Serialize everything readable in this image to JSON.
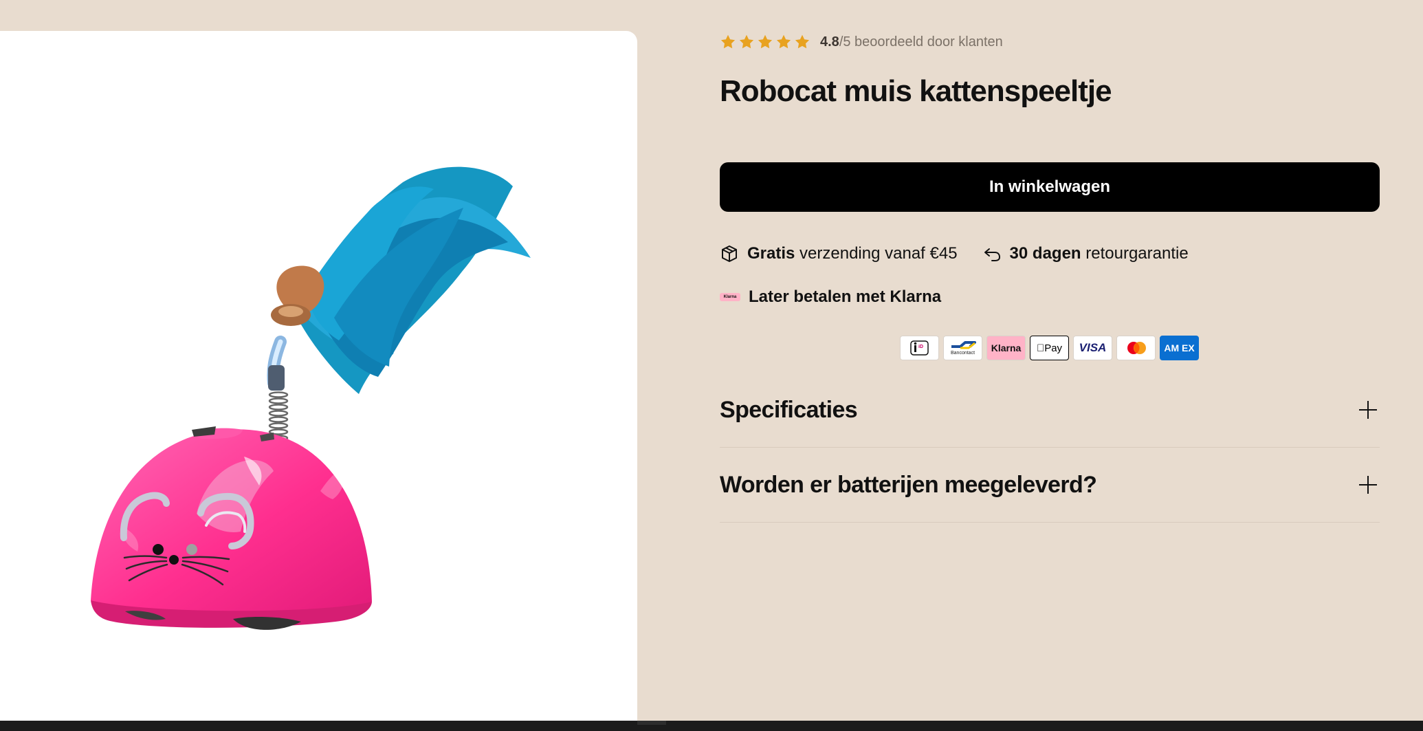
{
  "product": {
    "image_alt": "Robocat muis kattenspeeltje",
    "title": "Robocat muis kattenspeeltje",
    "rating": {
      "stars": 5,
      "score": "4.8",
      "suffix": "/5 beoordeeld door klanten"
    },
    "add_to_cart_label": "In winkelwagen"
  },
  "usps": [
    {
      "icon": "package-icon",
      "bold": "Gratis",
      "text": " verzending vanaf €45"
    },
    {
      "icon": "return-arrow-icon",
      "bold": "30 dagen",
      "text": " retourgarantie"
    }
  ],
  "klarna": {
    "badge": "Klarna",
    "label": "Later betalen met Klarna"
  },
  "payment_methods": [
    "iDEAL",
    "Bancontact",
    "Klarna",
    "Apple Pay",
    "VISA",
    "Mastercard",
    "AMEX"
  ],
  "payment_labels": {
    "ideal": "iD",
    "bancontact": "Bancontact",
    "klarna": "Klarna",
    "applepay": "Pay",
    "visa": "VISA",
    "amex": "AM EX"
  },
  "accordions": [
    {
      "title": "Specificaties"
    },
    {
      "title": "Worden er batterijen meegeleverd?"
    }
  ],
  "colors": {
    "background": "#e8dccf",
    "button": "#000000",
    "star": "#e8a220",
    "klarna_pink": "#ffb3c7",
    "visa_blue": "#1a1f71",
    "amex_blue": "#0a6fd1",
    "mouse_pink": "#ff2f8f",
    "feather_blue": "#1597c2"
  }
}
